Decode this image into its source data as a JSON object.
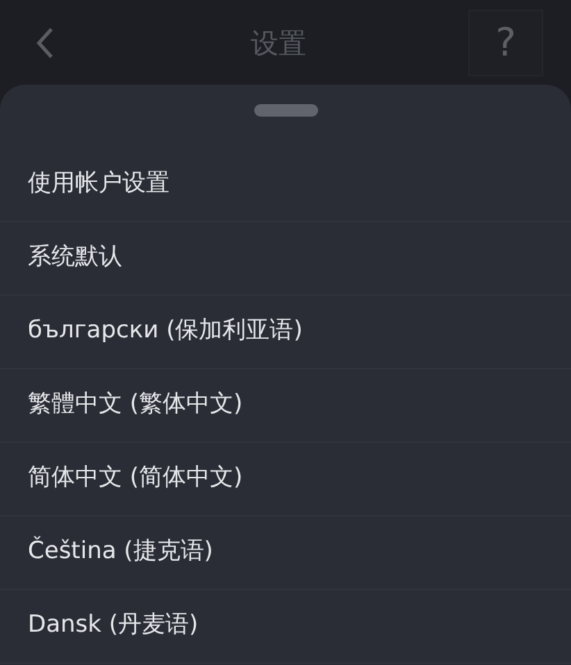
{
  "header": {
    "title": "设置",
    "help": "?"
  },
  "languages": [
    {
      "label": "使用帐户设置"
    },
    {
      "label": "系统默认"
    },
    {
      "label": "български (保加利亚语)"
    },
    {
      "label": "繁體中文 (繁体中文)"
    },
    {
      "label": "简体中文 (简体中文)"
    },
    {
      "label": "Čeština (捷克语)"
    },
    {
      "label": "Dansk (丹麦语)"
    }
  ]
}
